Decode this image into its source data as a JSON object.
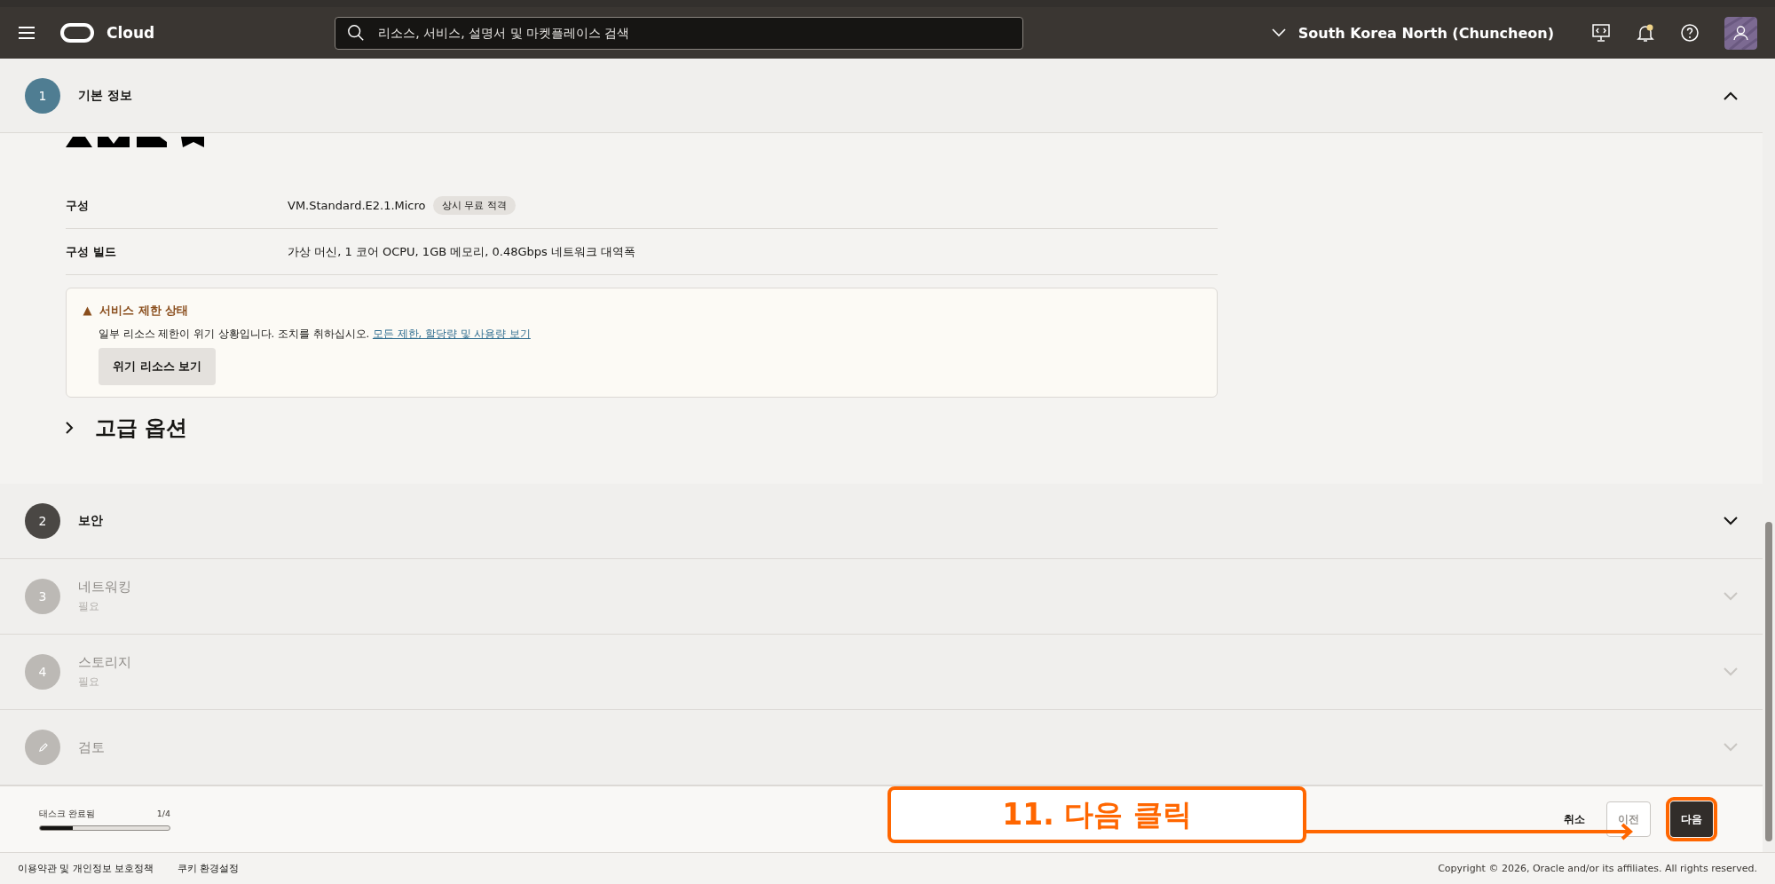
{
  "header": {
    "brand": "Cloud",
    "search": {
      "placeholder": "리소스, 서비스, 설명서 및 마켓플레이스 검색"
    },
    "region": "South Korea North (Chuncheon)"
  },
  "steps": [
    {
      "kind": "number",
      "number": "1",
      "title": "기본 정보",
      "expanded": true,
      "disabled": false,
      "content": {
        "rows": [
          {
            "label": "구성",
            "value": "VM.Standard.E2.1.Micro",
            "badge": "상시 무료 적격"
          },
          {
            "label": "구성 빌드",
            "value": "가상 머신, 1 코어 OCPU, 1GB 메모리, 0.48Gbps 네트워크 대역폭"
          }
        ],
        "alert": {
          "title": "서비스 제한 상태",
          "text": "일부 리소스 제한이 위기 상황입니다. 조치를 취하십시오.",
          "link": "모든 제한, 할당량 및 사용량 보기",
          "button": "위기 리소스 보기"
        },
        "advanced": {
          "label": "고급 옵션",
          "expanded": false
        }
      }
    },
    {
      "kind": "number",
      "number": "2",
      "title": "보안",
      "expanded": false,
      "disabled": false
    },
    {
      "kind": "number",
      "number": "3",
      "title": "네트워킹",
      "subtitle": "필요",
      "expanded": false,
      "disabled": true
    },
    {
      "kind": "number",
      "number": "4",
      "title": "스토리지",
      "subtitle": "필요",
      "expanded": false,
      "disabled": true
    },
    {
      "kind": "review",
      "title": "검토",
      "expanded": false,
      "disabled": true
    }
  ],
  "progress": {
    "label": "태스크 완료됨",
    "count": "1/4",
    "level": 0.25
  },
  "actions": [
    {
      "label": "취소",
      "kind": "link",
      "disabled": false
    },
    {
      "label": "이전",
      "kind": "outline",
      "disabled": true
    },
    {
      "label": "다음",
      "kind": "primary",
      "disabled": false
    }
  ],
  "annotation": {
    "text": "11. 다음 클릭"
  },
  "footer": {
    "links": [
      "이용약관 및 개인정보 보호정책",
      "쿠키 환경설정"
    ],
    "copyright": "Copyright © 2026, Oracle and/or its affiliates. All rights reserved."
  }
}
